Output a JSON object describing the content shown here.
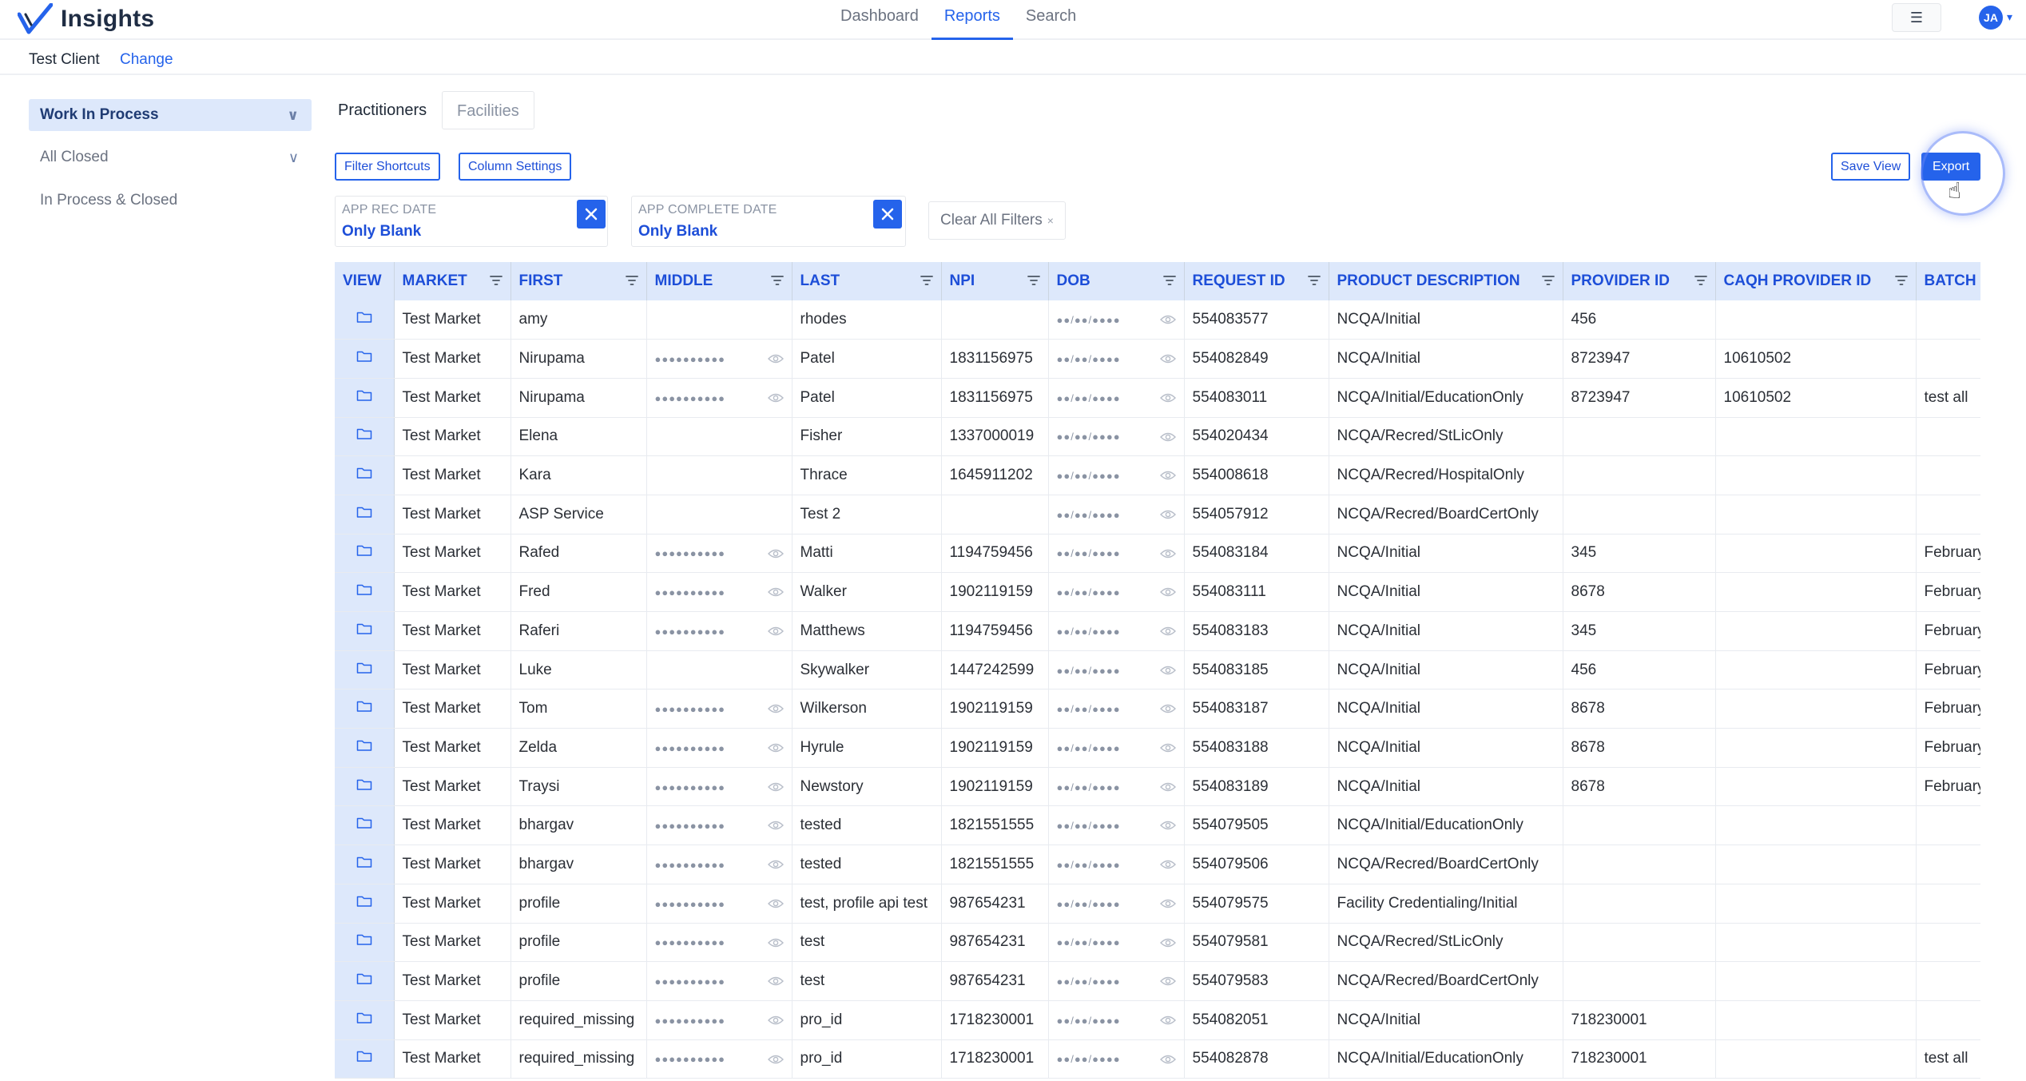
{
  "app": {
    "name": "Insights",
    "nav": [
      "Dashboard",
      "Reports",
      "Search"
    ],
    "active_nav": "Reports",
    "menu_icon": "hamburger-icon",
    "user_initials": "JA"
  },
  "client": {
    "name": "Test Client",
    "change_label": "Change"
  },
  "sidebar": {
    "items": [
      {
        "label": "Work In Process",
        "active": true,
        "chevron": true
      },
      {
        "label": "All Closed",
        "active": false,
        "chevron": true
      },
      {
        "label": "In Process & Closed",
        "active": false,
        "chevron": false
      }
    ]
  },
  "tabs": [
    {
      "label": "Practitioners",
      "active": true
    },
    {
      "label": "Facilities",
      "active": false
    }
  ],
  "toolbar": {
    "filter_shortcuts": "Filter Shortcuts",
    "column_settings": "Column Settings",
    "save_view": "Save View",
    "export": "Export"
  },
  "filters": [
    {
      "label": "APP REC DATE",
      "value": "Only Blank"
    },
    {
      "label": "APP COMPLETE DATE",
      "value": "Only Blank"
    }
  ],
  "clear_all": {
    "label": "Clear All Filters",
    "x": "×"
  },
  "table": {
    "columns": [
      "VIEW",
      "MARKET",
      "FIRST",
      "MIDDLE",
      "LAST",
      "NPI",
      "DOB",
      "REQUEST ID",
      "PRODUCT DESCRIPTION",
      "PROVIDER ID",
      "CAQH PROVIDER ID",
      "BATCH I"
    ],
    "masked_middle": "●●●●●●●●●●",
    "masked_dob": "●●/●●/●●●●",
    "rows": [
      {
        "market": "Test Market",
        "first": "amy",
        "middle": false,
        "last": "rhodes",
        "npi": "",
        "request_id": "554083577",
        "product": "NCQA/Initial",
        "provider_id": "456",
        "caqh": "",
        "batch": ""
      },
      {
        "market": "Test Market",
        "first": "Nirupama",
        "middle": true,
        "last": "Patel",
        "npi": "1831156975",
        "request_id": "554082849",
        "product": "NCQA/Initial",
        "provider_id": "8723947",
        "caqh": "10610502",
        "batch": ""
      },
      {
        "market": "Test Market",
        "first": "Nirupama",
        "middle": true,
        "last": "Patel",
        "npi": "1831156975",
        "request_id": "554083011",
        "product": "NCQA/Initial/EducationOnly",
        "provider_id": "8723947",
        "caqh": "10610502",
        "batch": "test all"
      },
      {
        "market": "Test Market",
        "first": "Elena",
        "middle": false,
        "last": "Fisher",
        "npi": "1337000019",
        "request_id": "554020434",
        "product": "NCQA/Recred/StLicOnly",
        "provider_id": "",
        "caqh": "",
        "batch": ""
      },
      {
        "market": "Test Market",
        "first": "Kara",
        "middle": false,
        "last": "Thrace",
        "npi": "1645911202",
        "request_id": "554008618",
        "product": "NCQA/Recred/HospitalOnly",
        "provider_id": "",
        "caqh": "",
        "batch": ""
      },
      {
        "market": "Test Market",
        "first": "ASP Service",
        "middle": false,
        "last": "Test 2",
        "npi": "",
        "request_id": "554057912",
        "product": "NCQA/Recred/BoardCertOnly",
        "provider_id": "",
        "caqh": "",
        "batch": ""
      },
      {
        "market": "Test Market",
        "first": "Rafed",
        "middle": true,
        "last": "Matti",
        "npi": "1194759456",
        "request_id": "554083184",
        "product": "NCQA/Initial",
        "provider_id": "345",
        "caqh": "",
        "batch": "February"
      },
      {
        "market": "Test Market",
        "first": "Fred",
        "middle": true,
        "last": "Walker",
        "npi": "1902119159",
        "request_id": "554083111",
        "product": "NCQA/Initial",
        "provider_id": "8678",
        "caqh": "",
        "batch": "February"
      },
      {
        "market": "Test Market",
        "first": "Raferi",
        "middle": true,
        "last": "Matthews",
        "npi": "1194759456",
        "request_id": "554083183",
        "product": "NCQA/Initial",
        "provider_id": "345",
        "caqh": "",
        "batch": "February"
      },
      {
        "market": "Test Market",
        "first": "Luke",
        "middle": false,
        "last": "Skywalker",
        "npi": "1447242599",
        "request_id": "554083185",
        "product": "NCQA/Initial",
        "provider_id": "456",
        "caqh": "",
        "batch": "February"
      },
      {
        "market": "Test Market",
        "first": "Tom",
        "middle": true,
        "last": "Wilkerson",
        "npi": "1902119159",
        "request_id": "554083187",
        "product": "NCQA/Initial",
        "provider_id": "8678",
        "caqh": "",
        "batch": "February"
      },
      {
        "market": "Test Market",
        "first": "Zelda",
        "middle": true,
        "last": "Hyrule",
        "npi": "1902119159",
        "request_id": "554083188",
        "product": "NCQA/Initial",
        "provider_id": "8678",
        "caqh": "",
        "batch": "February"
      },
      {
        "market": "Test Market",
        "first": "Traysi",
        "middle": true,
        "last": "Newstory",
        "npi": "1902119159",
        "request_id": "554083189",
        "product": "NCQA/Initial",
        "provider_id": "8678",
        "caqh": "",
        "batch": "February"
      },
      {
        "market": "Test Market",
        "first": "bhargav",
        "middle": true,
        "last": "tested",
        "npi": "1821551555",
        "request_id": "554079505",
        "product": "NCQA/Initial/EducationOnly",
        "provider_id": "",
        "caqh": "",
        "batch": ""
      },
      {
        "market": "Test Market",
        "first": "bhargav",
        "middle": true,
        "last": "tested",
        "npi": "1821551555",
        "request_id": "554079506",
        "product": "NCQA/Recred/BoardCertOnly",
        "provider_id": "",
        "caqh": "",
        "batch": ""
      },
      {
        "market": "Test Market",
        "first": "profile",
        "middle": true,
        "last": "test, profile api test",
        "npi": "987654231",
        "request_id": "554079575",
        "product": "Facility Credentialing/Initial",
        "provider_id": "",
        "caqh": "",
        "batch": ""
      },
      {
        "market": "Test Market",
        "first": "profile",
        "middle": true,
        "last": "test",
        "npi": "987654231",
        "request_id": "554079581",
        "product": "NCQA/Recred/StLicOnly",
        "provider_id": "",
        "caqh": "",
        "batch": ""
      },
      {
        "market": "Test Market",
        "first": "profile",
        "middle": true,
        "last": "test",
        "npi": "987654231",
        "request_id": "554079583",
        "product": "NCQA/Recred/BoardCertOnly",
        "provider_id": "",
        "caqh": "",
        "batch": ""
      },
      {
        "market": "Test Market",
        "first": "required_missing",
        "middle": true,
        "last": "pro_id",
        "npi": "1718230001",
        "request_id": "554082051",
        "product": "NCQA/Initial",
        "provider_id": "718230001",
        "caqh": "",
        "batch": ""
      },
      {
        "market": "Test Market",
        "first": "required_missing",
        "middle": true,
        "last": "pro_id",
        "npi": "1718230001",
        "request_id": "554082878",
        "product": "NCQA/Initial/EducationOnly",
        "provider_id": "718230001",
        "caqh": "",
        "batch": "test all"
      }
    ]
  },
  "colors": {
    "accent": "#2563eb",
    "header_bg": "#dde8fb",
    "text": "#2b2f36"
  }
}
